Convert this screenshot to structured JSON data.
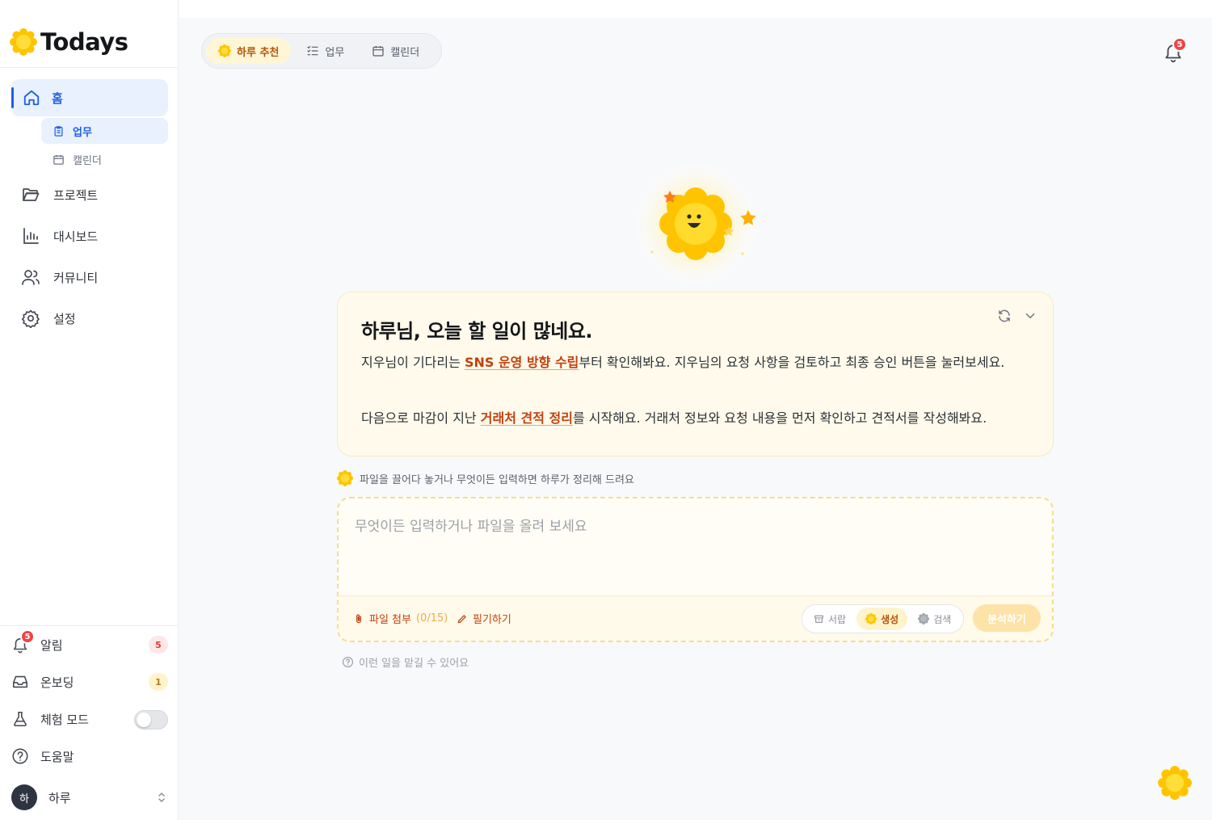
{
  "app": {
    "name": "Todays"
  },
  "sidebar": {
    "home": {
      "label": "홈"
    },
    "sub_items": [
      {
        "label": "업무",
        "active": true
      },
      {
        "label": "캘린더",
        "active": false
      }
    ],
    "items": [
      {
        "label": "프로젝트",
        "icon": "folder-icon"
      },
      {
        "label": "대시보드",
        "icon": "bar-chart-icon"
      },
      {
        "label": "커뮤니티",
        "icon": "users-icon"
      },
      {
        "label": "설정",
        "icon": "gear-icon"
      }
    ],
    "bottom": {
      "notifications": {
        "label": "알림",
        "count": "5",
        "badge": "5"
      },
      "onboarding": {
        "label": "온보딩",
        "count": "1"
      },
      "trial_mode": {
        "label": "체험 모드",
        "enabled": false
      },
      "help": {
        "label": "도움말"
      },
      "user": {
        "avatar_text": "하",
        "name": "하루"
      }
    }
  },
  "header": {
    "tabs": [
      {
        "label": "하루 추천",
        "active": true
      },
      {
        "label": "업무",
        "active": false
      },
      {
        "label": "캘린더",
        "active": false
      }
    ],
    "notification_badge": "5"
  },
  "card": {
    "title": "하루님, 오늘 할 일이 많네요.",
    "p1_before": "지우님이 기다리는 ",
    "p1_link": "SNS 운영 방향 수립",
    "p1_after": "부터 확인해봐요. 지우님의 요청 사항을 검토하고 최종 승인 버튼을 눌러보세요.",
    "p2_before": "다음으로 마감이 지난 ",
    "p2_link": "거래처 견적 정리",
    "p2_after": "를 시작해요. 거래처 정보와 요청 내용을 먼저 확인하고 견적서를 작성해봐요."
  },
  "composer": {
    "hint": "파일을 끌어다 놓거나 무엇이든 입력하면 하루가 정리해 드려요",
    "placeholder": "무엇이든 입력하거나 파일을 올려 보세요",
    "value": "",
    "attach_label": "파일 첨부",
    "attach_count": "(0/15)",
    "note_label": "필기하기",
    "modes": [
      {
        "label": "서랍",
        "active": false
      },
      {
        "label": "생성",
        "active": true
      },
      {
        "label": "검색",
        "active": false
      }
    ],
    "submit_label": "분석하기"
  },
  "help_link": "이런 일을 맡길 수 있어요",
  "colors": {
    "accent_blue": "#1d5fe6",
    "accent_orange": "#c2410c",
    "sun_yellow": "#ffd21f",
    "badge_red": "#ef4444"
  }
}
